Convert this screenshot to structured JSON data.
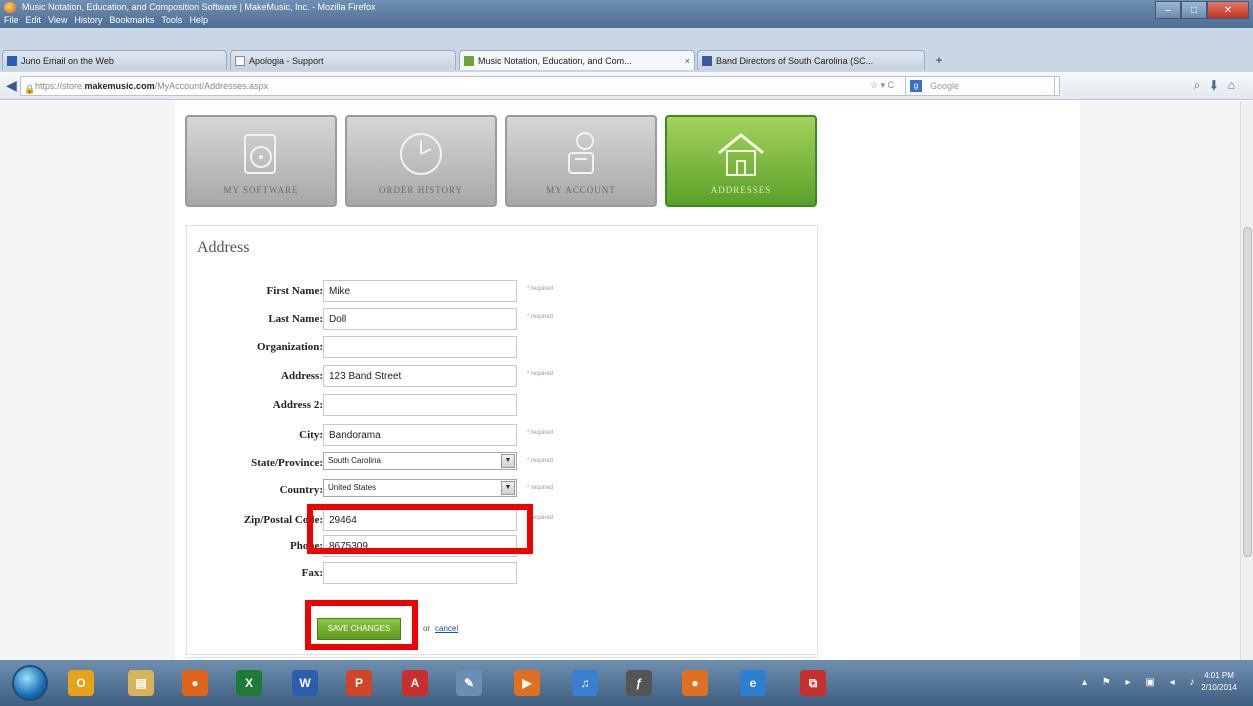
{
  "window": {
    "title": "Music Notation, Education, and Composition Software | MakeMusic, Inc. - Mozilla Firefox",
    "menu": [
      "File",
      "Edit",
      "View",
      "History",
      "Bookmarks",
      "Tools",
      "Help"
    ]
  },
  "tabs": [
    {
      "label": "Juno Email on the Web",
      "active": false
    },
    {
      "label": "Apologia - Support",
      "active": false
    },
    {
      "label": "Music Notation, Education, and Com...",
      "active": true
    },
    {
      "label": "Band Directors of South Carolina (SC...",
      "active": false
    }
  ],
  "nav": {
    "url_prefix": "https://store.",
    "url_domain": "makemusic.com",
    "url_path": "/MyAccount/Addresses.aspx",
    "search_placeholder": "Google"
  },
  "account_tiles": [
    {
      "label": "MY SOFTWARE",
      "icon": "software-disc-icon",
      "active": false
    },
    {
      "label": "ORDER HISTORY",
      "icon": "clock-icon",
      "active": false
    },
    {
      "label": "MY ACCOUNT",
      "icon": "user-account-icon",
      "active": false
    },
    {
      "label": "ADDRESSES",
      "icon": "house-icon",
      "active": true
    }
  ],
  "address_form": {
    "heading": "Address",
    "required_text": "* required",
    "fields": [
      {
        "label": "First Name:",
        "value": "Mike",
        "required": true,
        "type": "text"
      },
      {
        "label": "Last Name:",
        "value": "Doll",
        "required": true,
        "type": "text"
      },
      {
        "label": "Organization:",
        "value": "",
        "required": false,
        "type": "text"
      },
      {
        "label": "Address:",
        "value": "123 Band Street",
        "required": true,
        "type": "text"
      },
      {
        "label": "Address 2:",
        "value": "",
        "required": false,
        "type": "text"
      },
      {
        "label": "City:",
        "value": "Bandorama",
        "required": true,
        "type": "text"
      },
      {
        "label": "State/Province:",
        "value": "South Carolina",
        "required": true,
        "type": "select"
      },
      {
        "label": "Country:",
        "value": "United States",
        "required": true,
        "type": "select"
      },
      {
        "label": "Zip/Postal Code:",
        "value": "29464",
        "required": true,
        "type": "text"
      },
      {
        "label": "Phone:",
        "value": "8675309",
        "required": false,
        "type": "text"
      },
      {
        "label": "Fax:",
        "value": "",
        "required": false,
        "type": "text"
      }
    ],
    "save_label": "SAVE CHANGES",
    "or_text": "or",
    "cancel_label": "cancel"
  },
  "taskbar": {
    "apps": [
      {
        "name": "outlook-icon",
        "glyph": "O",
        "color": "#e8a21a"
      },
      {
        "name": "file-explorer-icon",
        "glyph": "▤",
        "color": "#d9b35a"
      },
      {
        "name": "firefox-icon",
        "glyph": "●",
        "color": "#e0651a"
      },
      {
        "name": "excel-icon",
        "glyph": "X",
        "color": "#1f7a3a"
      },
      {
        "name": "word-icon",
        "glyph": "W",
        "color": "#2b5fae"
      },
      {
        "name": "powerpoint-icon",
        "glyph": "P",
        "color": "#d0452a"
      },
      {
        "name": "acrobat-icon",
        "glyph": "A",
        "color": "#c9302c"
      },
      {
        "name": "paint-icon",
        "glyph": "✎",
        "color": "#6a8fb5"
      },
      {
        "name": "media-player-icon",
        "glyph": "▶",
        "color": "#e07020"
      },
      {
        "name": "itunes-icon",
        "glyph": "♫",
        "color": "#3a7fd0"
      },
      {
        "name": "finale-icon",
        "glyph": "ƒ",
        "color": "#555555"
      },
      {
        "name": "app-orange-icon",
        "glyph": "●",
        "color": "#e07020"
      },
      {
        "name": "ie-icon",
        "glyph": "e",
        "color": "#2f7fd1"
      },
      {
        "name": "pdf-icon",
        "glyph": "⧉",
        "color": "#c9302c"
      }
    ],
    "time": "4:01 PM",
    "date": "2/10/2014"
  },
  "colors": {
    "accent_green": "#5aa02a",
    "highlight_red": "#ee0000",
    "link_blue": "#1a4fb0"
  }
}
